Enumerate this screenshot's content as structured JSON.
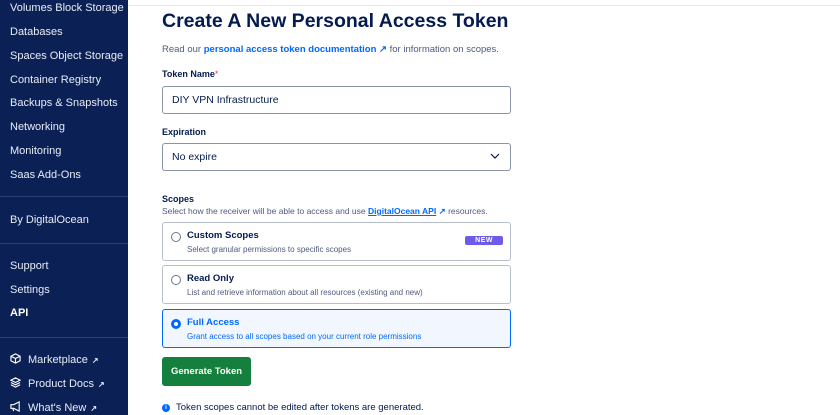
{
  "sidebar": {
    "items": [
      {
        "label": "Volumes Block Storage"
      },
      {
        "label": "Databases"
      },
      {
        "label": "Spaces Object Storage"
      },
      {
        "label": "Container Registry"
      },
      {
        "label": "Backups & Snapshots"
      },
      {
        "label": "Networking"
      },
      {
        "label": "Monitoring"
      },
      {
        "label": "Saas Add-Ons"
      }
    ],
    "by_do": "By DigitalOcean",
    "support": "Support",
    "settings": "Settings",
    "api": "API",
    "marketplace": "Marketplace",
    "product_docs": "Product Docs",
    "whats_new": "What's New",
    "ext_arrow": "↗"
  },
  "main": {
    "title": "Create A New Personal Access Token",
    "intro_pre": "Read our ",
    "intro_link": "personal access token documentation",
    "intro_post": " for information on scopes.",
    "ext_arrow": "↗",
    "token_name_label": "Token Name",
    "required_mark": "*",
    "token_name_value": "DIY VPN Infrastructure",
    "expiration_label": "Expiration",
    "expiration_value": "No expire",
    "scopes_label": "Scopes",
    "scopes_desc_pre": "Select how the receiver will be able to access and use ",
    "scopes_desc_link": "DigitalOcean API",
    "scopes_desc_post": " resources.",
    "options": [
      {
        "title": "Custom Scopes",
        "sub": "Select granular permissions to specific scopes",
        "badge": "NEW"
      },
      {
        "title": "Read Only",
        "sub": "List and retrieve information about all resources (existing and new)"
      },
      {
        "title": "Full Access",
        "sub": "Grant access to all scopes based on your current role permissions"
      }
    ],
    "generate_label": "Generate Token",
    "info_icon": "i",
    "info_text": "Token scopes cannot be edited after tokens are generated."
  },
  "colors": {
    "sidebar_bg": "#0b2156",
    "accent": "#0069ff",
    "button_green": "#15803d",
    "badge_purple": "#6c5ce7"
  }
}
